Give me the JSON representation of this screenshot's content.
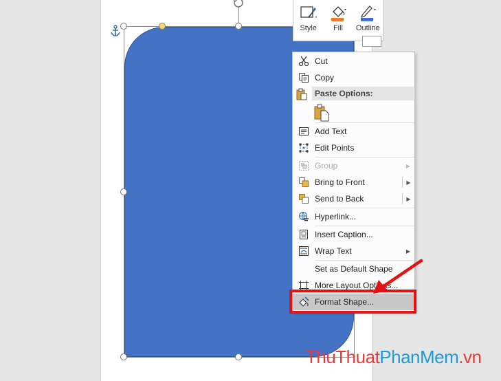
{
  "mini_toolbar": {
    "style_label": "Style",
    "fill_label": "Fill",
    "outline_label": "Outline"
  },
  "colors": {
    "shape_fill": "#4472c4",
    "fill_swatch": "#ed7d31",
    "outline_swatch": "#4472c4",
    "highlight_box": "#e41313",
    "watermark_red": "#e83b3b",
    "watermark_blue": "#1e9bd7"
  },
  "context_menu": {
    "cut": "Cut",
    "copy": "Copy",
    "paste_options": "Paste Options:",
    "add_text": "Add Text",
    "edit_points": "Edit Points",
    "group": "Group",
    "bring_to_front": "Bring to Front",
    "send_to_back": "Send to Back",
    "hyperlink": "Hyperlink...",
    "insert_caption": "Insert Caption...",
    "wrap_text": "Wrap Text",
    "set_default": "Set as Default Shape",
    "more_layout": "More Layout Options...",
    "format_shape": "Format Shape..."
  },
  "watermark": {
    "part1": "ThuThuat",
    "part2": "PhanMem",
    "part3": ".vn"
  }
}
